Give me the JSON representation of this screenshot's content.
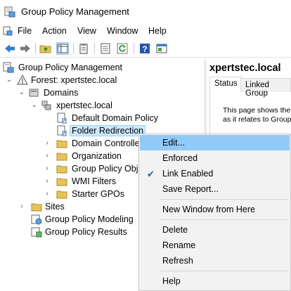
{
  "window": {
    "title": "Group Policy Management"
  },
  "menu": [
    "File",
    "Action",
    "View",
    "Window",
    "Help"
  ],
  "tree": {
    "root": "Group Policy Management",
    "forest": "Forest: xpertstec.local",
    "domains": "Domains",
    "domain": "xpertstec.local",
    "children": [
      "Default Domain Policy",
      "Folder Redirection",
      "Domain Controlle",
      "Organization",
      "Group Policy Obje",
      "WMI Filters",
      "Starter GPOs"
    ],
    "sites": "Sites",
    "modeling": "Group Policy Modeling",
    "results": "Group Policy Results"
  },
  "right_pane": {
    "title": "xpertstec.local",
    "tabs": [
      "Status",
      "Linked Group"
    ],
    "text_line1": "This page shows the",
    "text_line2": "as it relates to Group"
  },
  "context_menu": {
    "items": [
      "Edit...",
      "Enforced",
      "Link Enabled",
      "Save Report...",
      "New Window from Here",
      "Delete",
      "Rename",
      "Refresh",
      "Help"
    ],
    "checked": "Link Enabled",
    "highlighted": "Edit..."
  },
  "colors": {
    "highlight": "#91c9f7",
    "selection": "#cce8ff",
    "folder": "#e8c35a"
  }
}
